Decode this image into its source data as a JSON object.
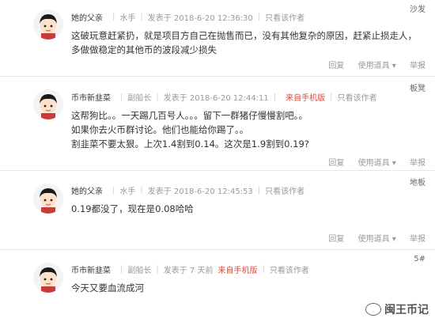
{
  "posts": [
    {
      "author": "她的父亲",
      "rank": "水手",
      "posted": "发表于 2018-6-20 12:36:30",
      "only_author": "只看该作者",
      "mobile": "",
      "floor": "沙发",
      "lines": [
        "这破玩意赶紧扔，就是项目方自己在抛售而已，没有其他复杂的原因，赶紧止损走人，多做做稳定的其他币的波段减少损失"
      ],
      "reply": "回复",
      "use_item": "使用道具 ▾",
      "report": "举报"
    },
    {
      "author": "币市新韭菜",
      "rank": "副船长",
      "posted": "发表于 2018-6-20 12:44:11",
      "only_author": "只看该作者",
      "mobile": "来自手机版",
      "floor": "板凳",
      "lines": [
        "这帮狗比。。一天踢几百号人。。。留下一群猪仔慢慢割吧。。",
        "如果你去火币群讨论。他们也能给你踢了。。",
        "割韭菜不要太狠。上次1.4割到0.14。这次是1.9割到0.19?"
      ],
      "reply": "回复",
      "use_item": "使用道具 ▾",
      "report": "举报"
    },
    {
      "author": "她的父亲",
      "rank": "水手",
      "posted": "发表于 2018-6-20 12:45:53",
      "only_author": "只看该作者",
      "mobile": "",
      "floor": "地板",
      "lines": [
        "0.19都没了，现在是0.08哈哈"
      ],
      "reply": "回复",
      "use_item": "使用道具 ▾",
      "report": "举报"
    },
    {
      "author": "币市新韭菜",
      "rank": "副船长",
      "posted": "发表于 7 天前",
      "only_author": "只看该作者",
      "mobile": "来自手机版",
      "floor": "5#",
      "lines": [
        "今天又要血流成河"
      ],
      "reply": "",
      "use_item": "",
      "report": ""
    }
  ],
  "watermark": "闽王币记"
}
